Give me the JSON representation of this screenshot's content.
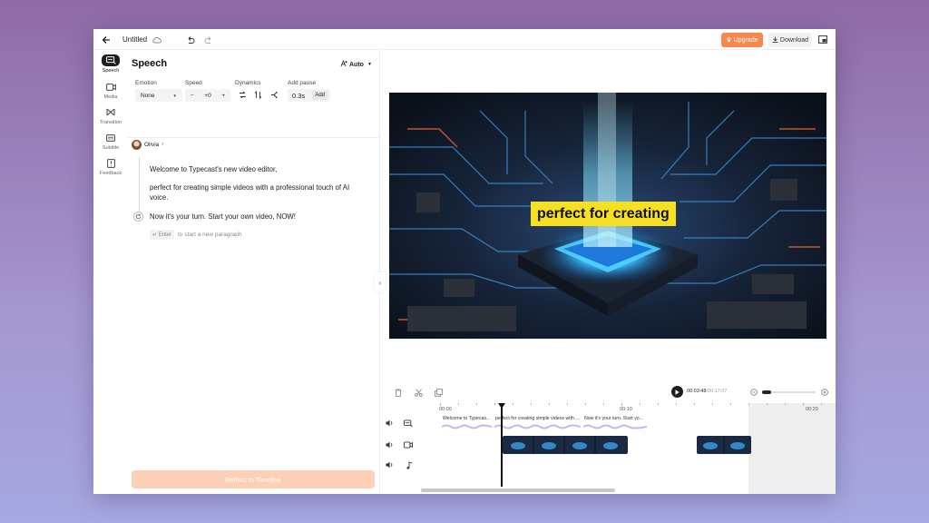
{
  "header": {
    "title": "Untitled",
    "upgrade_label": "Upgrade",
    "download_label": "Download"
  },
  "rail": {
    "items": [
      {
        "label": "Speech",
        "icon": "speech-icon",
        "active": true
      },
      {
        "label": "Media",
        "icon": "media-icon"
      },
      {
        "label": "Transition",
        "icon": "transition-icon"
      },
      {
        "label": "Subtitle",
        "icon": "subtitle-icon"
      },
      {
        "label": "Feedback",
        "icon": "feedback-icon"
      }
    ]
  },
  "speech_panel": {
    "title": "Speech",
    "auto_label": "Auto",
    "controls": {
      "emotion_label": "Emotion",
      "emotion_value": "None",
      "speed_label": "Speed",
      "speed_value": "+0",
      "minus": "−",
      "plus": "+",
      "dynamics_label": "Dynamics",
      "pause_label": "Add pause",
      "pause_value": "0.3s",
      "pause_add": "Add"
    },
    "voice_name": "Olivia",
    "paragraphs": [
      "Welcome to Typecast's new video editor,",
      "perfect for creating simple videos with a professional touch of AI",
      "voice.",
      "Now it's your turn. Start your own video, NOW!"
    ],
    "enter_key": "↵ Enter",
    "enter_hint": "to start a new paragraph",
    "reflect_label": "Reflect to Timeline"
  },
  "preview": {
    "subtitle": "perfect for creating"
  },
  "timeline": {
    "current_time": "00:03:48",
    "total_time": "/00:17:07",
    "ruler_labels": [
      "00:00",
      "00:10",
      "00:20"
    ],
    "speech_segments": [
      "Welcome to Typecas...",
      "perfect for creating simple videos with ...",
      "Now it's your turn. Start yo..."
    ]
  },
  "colors": {
    "upgrade": "#f6884d",
    "subtitle_bg": "#f7e022",
    "reflect": "#fbd0b6",
    "waveform": "#c9b6ef"
  }
}
